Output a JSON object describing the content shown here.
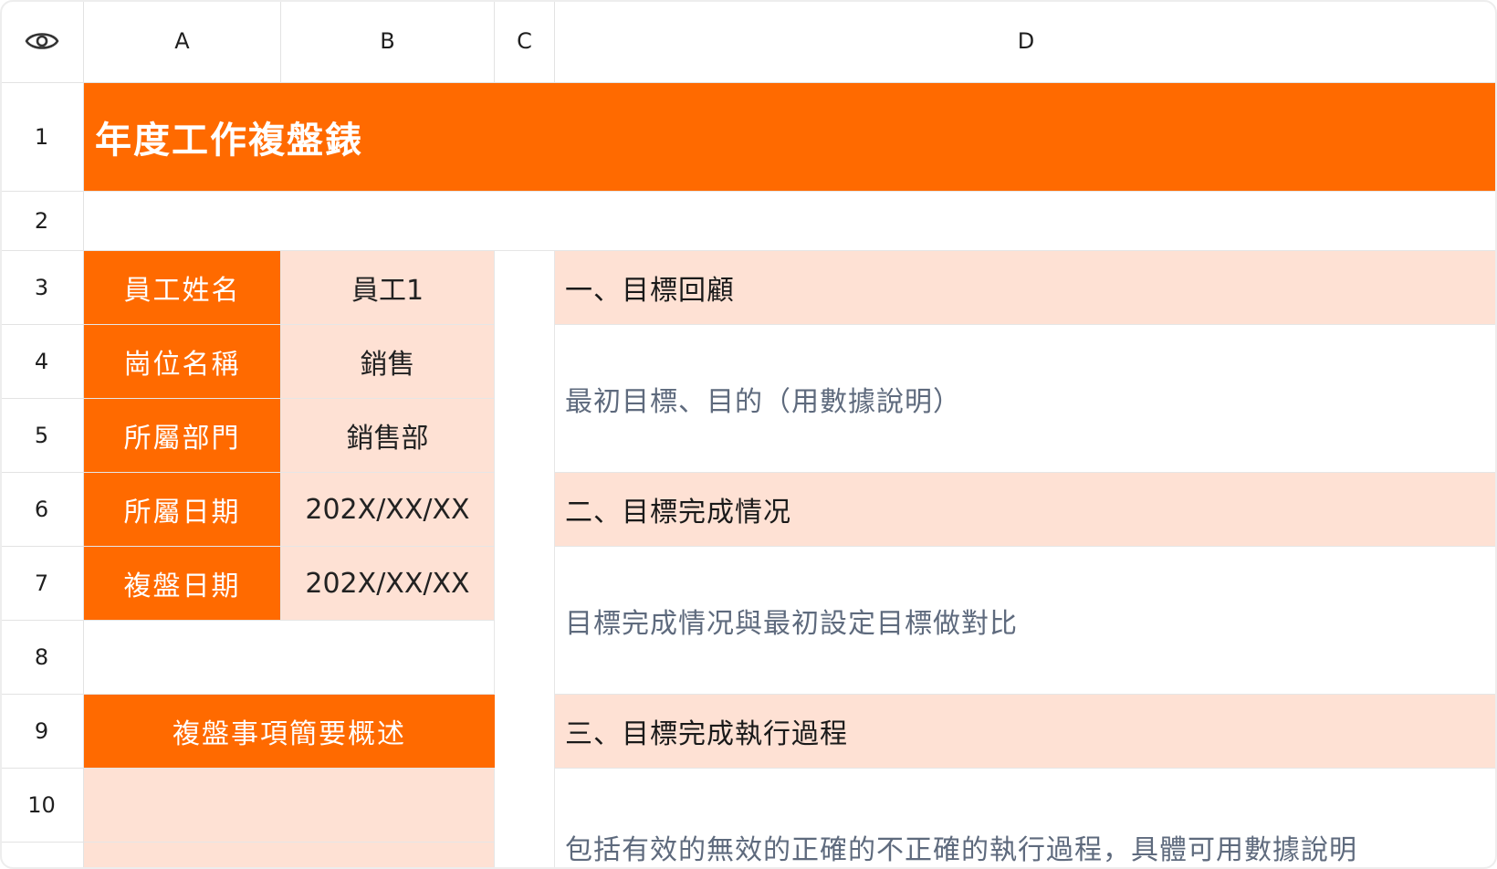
{
  "column_headers": [
    "A",
    "B",
    "C",
    "D"
  ],
  "row_headers": [
    "1",
    "2",
    "3",
    "4",
    "5",
    "6",
    "7",
    "8",
    "9",
    "10"
  ],
  "title": "年度工作複盤錶",
  "info_fields": [
    {
      "label": "員工姓名",
      "value": "員工1"
    },
    {
      "label": "崗位名稱",
      "value": "銷售"
    },
    {
      "label": "所屬部門",
      "value": "銷售部"
    },
    {
      "label": "所屬日期",
      "value": "202X/XX/XX"
    },
    {
      "label": "複盤日期",
      "value": "202X/XX/XX"
    }
  ],
  "summary_header": "複盤事項簡要概述",
  "sections": [
    {
      "heading": "一、目標回顧",
      "hint": "最初目標、目的（用數據說明）"
    },
    {
      "heading": "二、目標完成情况",
      "hint": "目標完成情况與最初設定目標做對比"
    },
    {
      "heading": "三、目標完成執行過程",
      "hint": "包括有效的無效的正確的不正確的執行過程，具體可用數據說明"
    }
  ],
  "icons": {
    "view_toggle": "eye-icon"
  },
  "colors": {
    "accent": "#ff6a00",
    "accent_light": "#fee1d4"
  }
}
